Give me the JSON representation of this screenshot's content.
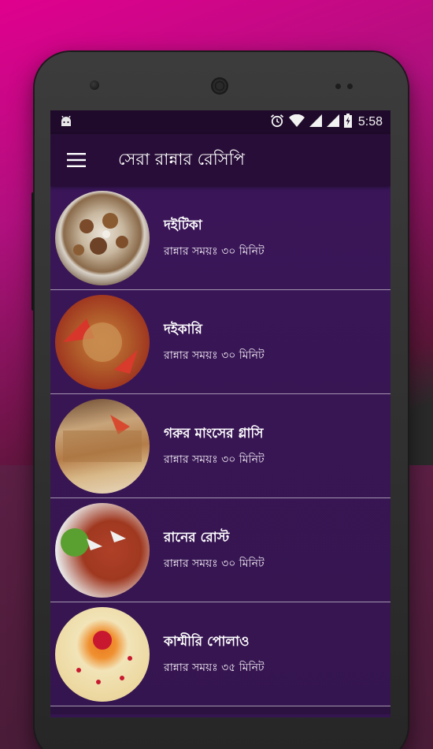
{
  "status_bar": {
    "time": "5:58",
    "icons": [
      "android-notification-icon",
      "alarm-icon",
      "wifi-icon",
      "signal-icon",
      "signal-icon-2",
      "battery-charging-icon"
    ]
  },
  "app_bar": {
    "menu_icon": "hamburger-menu-icon",
    "title": "সেরা রান্নার রেসিপি"
  },
  "recipes": [
    {
      "title": "দইটিকা",
      "time": "রান্নার সময়ঃ ৩০ মিনিট"
    },
    {
      "title": "দইকারি",
      "time": "রান্নার সময়ঃ ৩০ মিনিট"
    },
    {
      "title": "গরুর মাংসের গ্লাসি",
      "time": "রান্নার সময়ঃ ৩০ মিনিট"
    },
    {
      "title": "রানের রোস্ট",
      "time": "রান্নার সময়ঃ ৩০ মিনিট"
    },
    {
      "title": "কাশ্মীরি পোলাও",
      "time": "রান্নার সময়ঃ ৩৫ মিনিট"
    }
  ],
  "colors": {
    "status_bar": "#1f0a2b",
    "app_bar": "#270d37",
    "list_background": "#3a1658",
    "text": "#ffffff"
  }
}
